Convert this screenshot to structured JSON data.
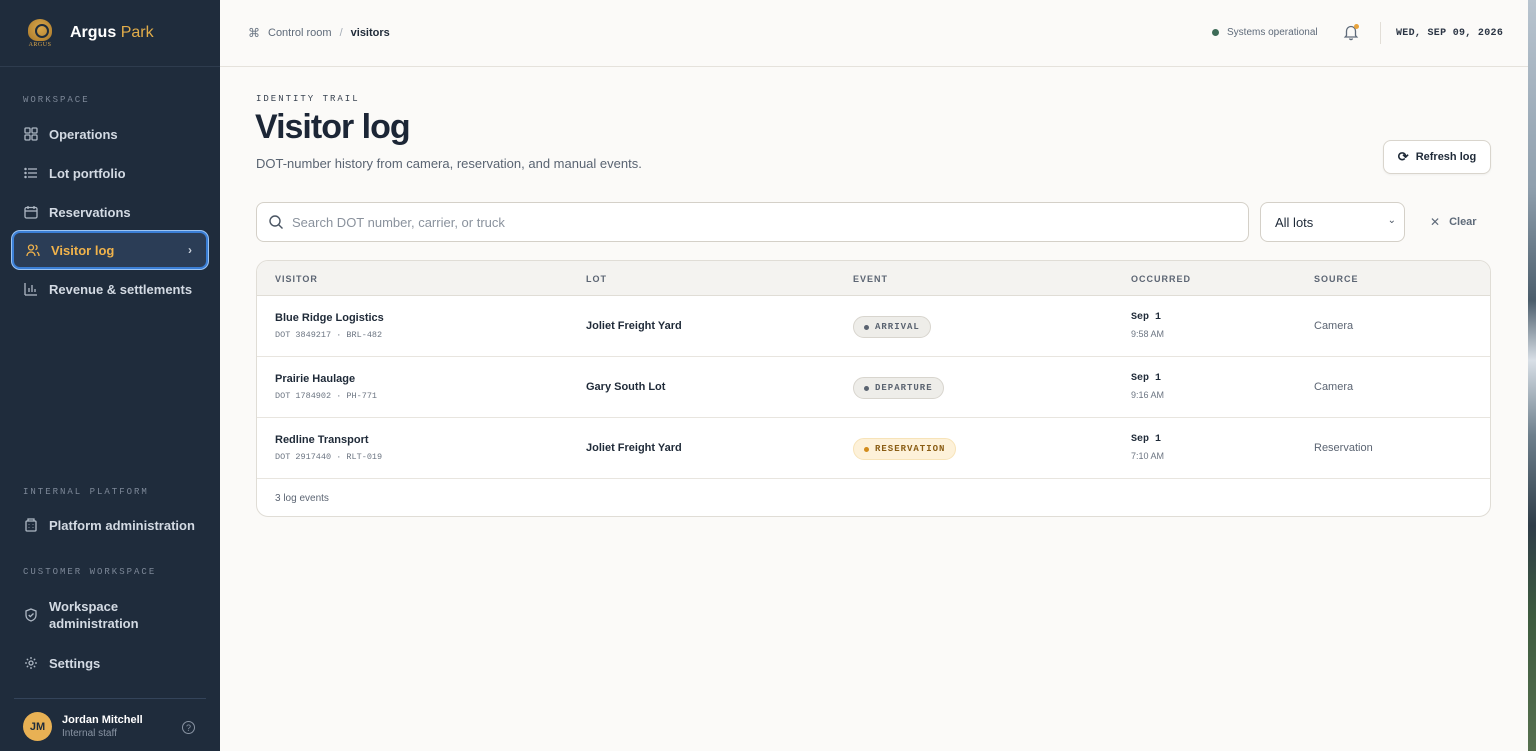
{
  "brand": {
    "logo_text": "ARGUS",
    "name_primary": "Argus",
    "name_accent": "Park"
  },
  "sidebar": {
    "workspace_label": "WORKSPACE",
    "items": [
      {
        "label": "Operations",
        "icon": "grid-icon"
      },
      {
        "label": "Lot portfolio",
        "icon": "list-icon"
      },
      {
        "label": "Reservations",
        "icon": "calendar-icon"
      },
      {
        "label": "Visitor log",
        "icon": "users-icon",
        "active": true
      },
      {
        "label": "Revenue & settlements",
        "icon": "bar-chart-icon"
      }
    ],
    "internal_label": "INTERNAL PLATFORM",
    "platform_admin": "Platform administration",
    "customer_label": "CUSTOMER WORKSPACE",
    "workspace_admin": "Workspace administration",
    "settings": "Settings"
  },
  "user": {
    "initials": "JM",
    "name": "Jordan Mitchell",
    "role": "Internal staff"
  },
  "topbar": {
    "breadcrumb_root": "Control room",
    "breadcrumb_sep": "/",
    "breadcrumb_current": "visitors",
    "status": "Systems operational",
    "date": "WED, SEP 09, 2026"
  },
  "page": {
    "eyebrow": "IDENTITY TRAIL",
    "title": "Visitor log",
    "subtitle": "DOT-number history from camera, reservation, and manual events.",
    "refresh_label": "Refresh log"
  },
  "filters": {
    "search_placeholder": "Search DOT number, carrier, or truck",
    "search_value": "",
    "lot_selected": "All lots",
    "clear_label": "Clear"
  },
  "table": {
    "columns": [
      "VISITOR",
      "LOT",
      "EVENT",
      "OCCURRED",
      "SOURCE"
    ],
    "rows": [
      {
        "name": "Blue Ridge Logistics",
        "sub": "DOT 3849217 · BRL-482",
        "lot": "Joliet Freight Yard",
        "event": "ARRIVAL",
        "date": "Sep 1",
        "time": "9:58 AM",
        "source": "Camera"
      },
      {
        "name": "Prairie Haulage",
        "sub": "DOT 1784902 · PH-771",
        "lot": "Gary South Lot",
        "event": "DEPARTURE",
        "date": "Sep 1",
        "time": "9:16 AM",
        "source": "Camera"
      },
      {
        "name": "Redline Transport",
        "sub": "DOT 2917440 · RLT-019",
        "lot": "Joliet Freight Yard",
        "event": "RESERVATION",
        "date": "Sep 1",
        "time": "7:10 AM",
        "source": "Reservation"
      }
    ],
    "footer": "3 log events"
  },
  "colors": {
    "sidebar_bg": "#1f2c3c",
    "accent": "#f1b34b",
    "active_border": "#3b7fd6",
    "status_dot": "#3d6b57",
    "reservation_badge_bg": "#fdf1d9"
  }
}
